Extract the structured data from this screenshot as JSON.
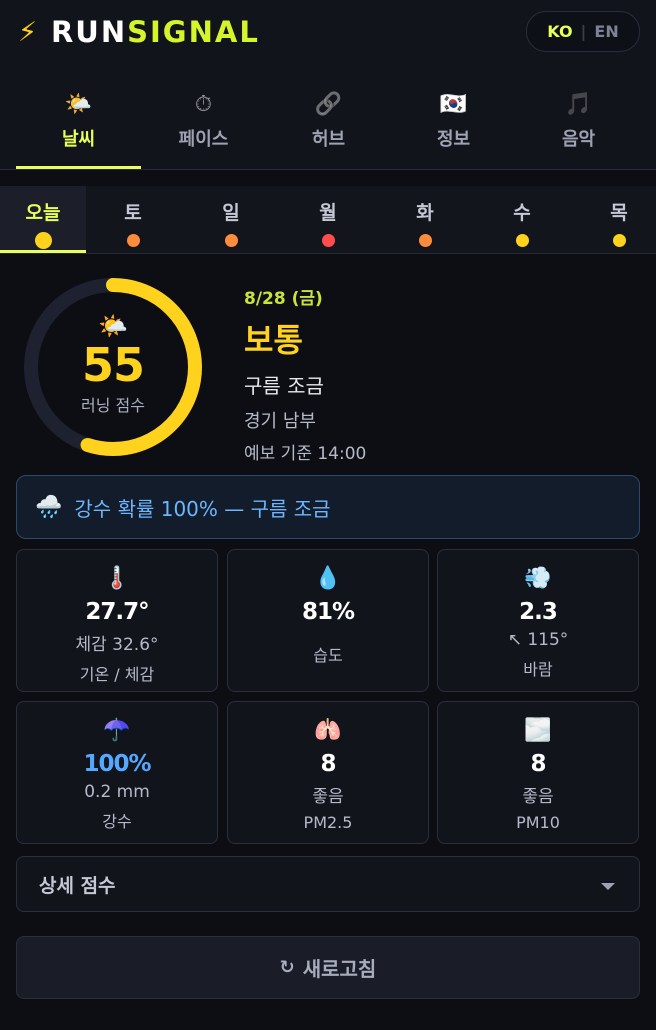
{
  "header": {
    "bolt_icon": "⚡",
    "logo_part1": "RUN",
    "logo_part2": "SIGNAL",
    "lang_ko": "KO",
    "lang_en": "EN"
  },
  "main_tabs": [
    {
      "icon": "🌤️",
      "label": "날씨"
    },
    {
      "icon": "⏱",
      "label": "페이스"
    },
    {
      "icon": "🔗",
      "label": "허브"
    },
    {
      "icon": "🇰🇷",
      "label": "정보"
    },
    {
      "icon": "🎵",
      "label": "음악"
    }
  ],
  "days": [
    {
      "label": "오늘",
      "color": "#ffd21e"
    },
    {
      "label": "토",
      "color": "#ff8c3a"
    },
    {
      "label": "일",
      "color": "#ff8c3a"
    },
    {
      "label": "월",
      "color": "#ff4d4d"
    },
    {
      "label": "화",
      "color": "#ff8c3a"
    },
    {
      "label": "수",
      "color": "#ffd21e"
    },
    {
      "label": "목",
      "color": "#ffd21e"
    }
  ],
  "score": {
    "icon": "🌤️",
    "value": 55,
    "max": 100,
    "label": "러닝 점수"
  },
  "forecast": {
    "date": "8/28 (금)",
    "status": "보통",
    "condition": "구름 조금",
    "region": "경기 남부",
    "base_time": "예보 기준 14:00"
  },
  "alert": {
    "icon": "🌧️",
    "text": "강수 확률 100% — 구름 조금"
  },
  "cards": [
    {
      "icon": "🌡️",
      "value": "27.7°",
      "sub": "체감 32.6°",
      "label": "기온 / 체감"
    },
    {
      "icon": "💧",
      "value": "81%",
      "sub": "",
      "label": "습도"
    },
    {
      "icon": "💨",
      "value": "2.3",
      "sub": "↖ 115°",
      "label": "바람"
    },
    {
      "icon": "☂️",
      "value": "100%",
      "sub": "0.2 mm",
      "label": "강수"
    },
    {
      "icon": "🫁",
      "value": "8",
      "sub": "좋음",
      "label": "PM2.5"
    },
    {
      "icon": "🌫️",
      "value": "8",
      "sub": "좋음",
      "label": "PM10"
    }
  ],
  "detail": {
    "label": "상세 점수"
  },
  "refresh": {
    "icon": "↻",
    "label": "새로고침"
  },
  "colors": {
    "accent": "#e9ff5a",
    "score": "#ffd21e",
    "rain": "#55a8ff"
  }
}
